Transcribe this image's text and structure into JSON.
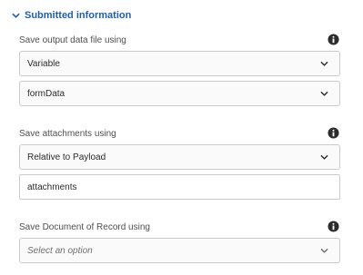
{
  "section": {
    "title": "Submitted information",
    "icon": "chevron-down-icon"
  },
  "fields": {
    "output_data_file": {
      "label": "Save output data file using",
      "mode_value": "Variable",
      "variable_value": "formData"
    },
    "attachments": {
      "label": "Save attachments using",
      "mode_value": "Relative to Payload",
      "path_value": "attachments"
    },
    "document_of_record": {
      "label": "Save Document of Record using",
      "placeholder": "Select an option"
    }
  },
  "colors": {
    "accent": "#1f5fad",
    "border": "#cacaca",
    "label": "#505050",
    "icon": "#2c2c2c"
  }
}
